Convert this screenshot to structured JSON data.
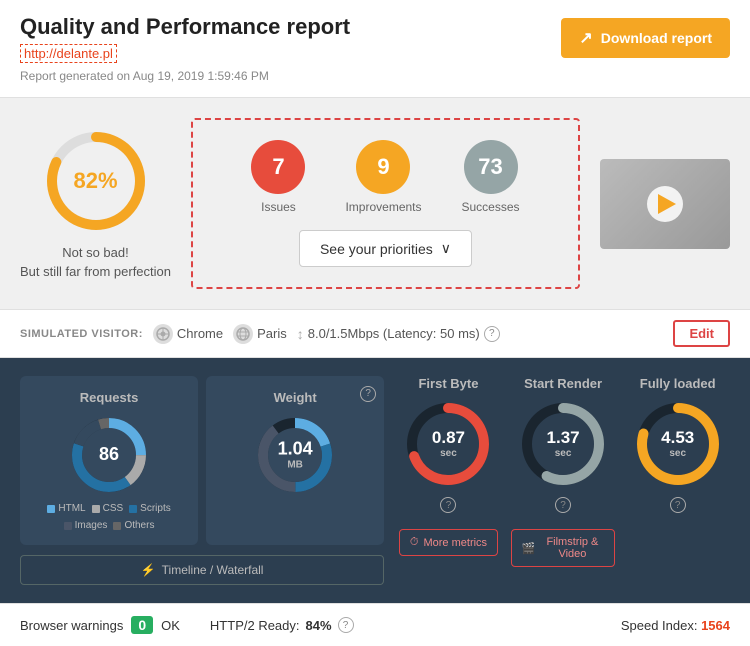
{
  "header": {
    "title": "Quality and Performance report",
    "url": "http://delante.pl",
    "generated": "Report generated on Aug 19, 2019 1:59:46 PM",
    "download_label": "Download report"
  },
  "score": {
    "percent": "82%",
    "label_line1": "Not so bad!",
    "label_line2": "But still far from perfection"
  },
  "issues": {
    "count": 7,
    "label": "Issues"
  },
  "improvements": {
    "count": 9,
    "label": "Improvements"
  },
  "successes": {
    "count": 73,
    "label": "Successes"
  },
  "priorities_btn": "See your priorities",
  "visitor": {
    "label": "SIMULATED VISITOR:",
    "browser": "Chrome",
    "location": "Paris",
    "connection": "8.0/1.5Mbps (Latency: 50 ms)",
    "edit_label": "Edit"
  },
  "metrics": {
    "requests": {
      "label": "Requests",
      "value": "86",
      "legend": [
        {
          "color": "#5dade2",
          "label": "HTML"
        },
        {
          "color": "#aaaaaa",
          "label": "CSS"
        },
        {
          "color": "#2471a3",
          "label": "Scripts"
        },
        {
          "color": "#34495e",
          "label": "Images"
        },
        {
          "color": "#555",
          "label": "Others"
        }
      ]
    },
    "weight": {
      "label": "Weight",
      "value": "1.04",
      "unit": "MB"
    },
    "timeline_btn": "Timeline / Waterfall",
    "first_byte": {
      "label": "First Byte",
      "value": "0.87",
      "unit": "sec"
    },
    "start_render": {
      "label": "Start Render",
      "value": "1.37",
      "unit": "sec"
    },
    "fully_loaded": {
      "label": "Fully loaded",
      "value": "4.53",
      "unit": "sec"
    },
    "more_metrics_btn": "More metrics",
    "filmstrip_btn": "Filmstrip & Video"
  },
  "warnings": {
    "label": "Browser warnings",
    "count": "0",
    "status": "OK",
    "http2_label": "HTTP/2 Ready:",
    "http2_value": "84%",
    "speed_label": "Speed Index:",
    "speed_value": "1564"
  }
}
